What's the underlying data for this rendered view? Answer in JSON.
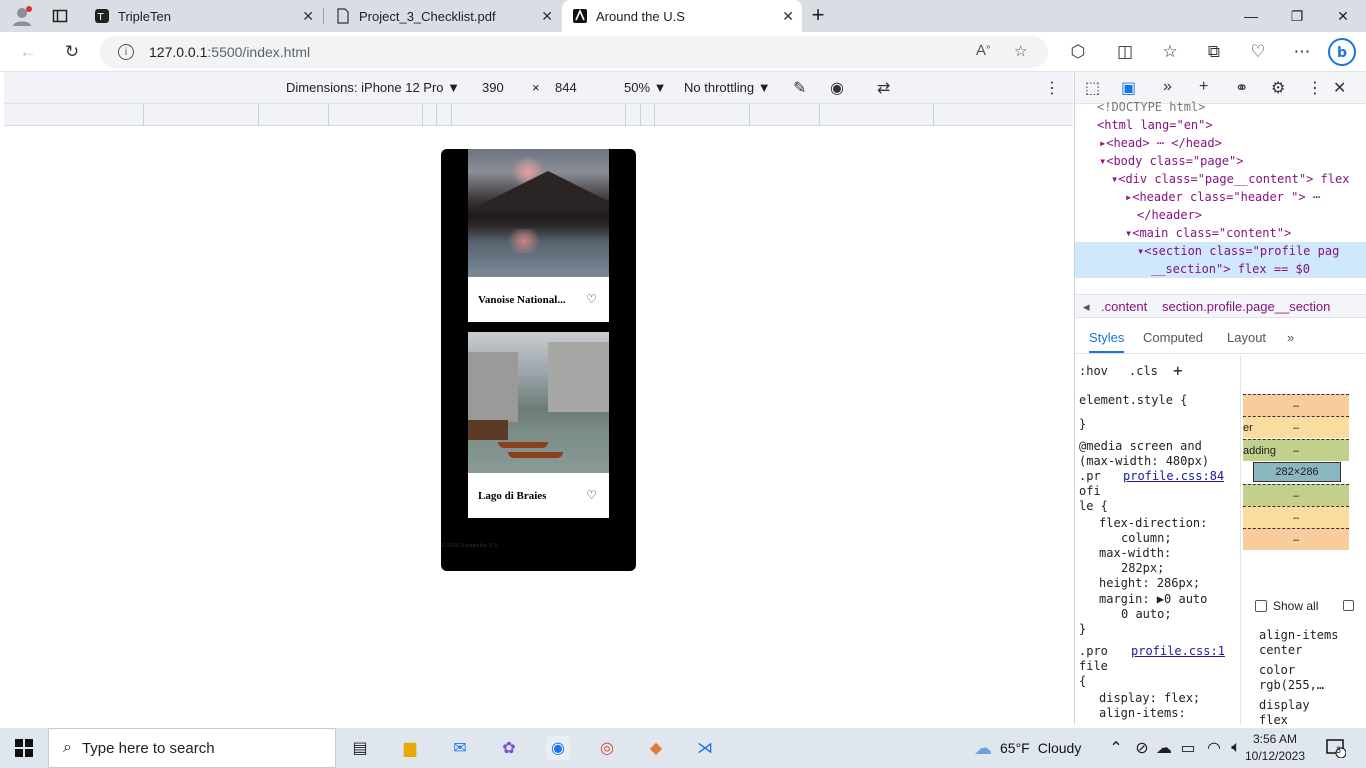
{
  "browser": {
    "tabs": [
      {
        "label": "TripleTen",
        "icon": "tripleten-icon"
      },
      {
        "label": "Project_3_Checklist.pdf",
        "icon": "pdf-icon"
      },
      {
        "label": "Around the U.S",
        "icon": "around-icon"
      }
    ],
    "new_tab": "+",
    "url_host": "127.0.0.1",
    "url_rest": ":5500/index.html"
  },
  "device_toolbar": {
    "dimensions_label": "Dimensions: iPhone 12 Pro",
    "width": "390",
    "times": "×",
    "height": "844",
    "zoom": "50%",
    "throttling": "No throttling"
  },
  "page": {
    "cards": [
      {
        "title": "Vanoise National...",
        "liked": false
      },
      {
        "title": "Lago di Braies",
        "liked": false
      }
    ],
    "footer": "© 2020 Around the U.S"
  },
  "devtools": {
    "dom_lines": [
      {
        "text": "<!DOCTYPE html>"
      },
      {
        "text": "<html lang=\"en\">"
      },
      {
        "text": "▸<head> ⋯ </head>"
      },
      {
        "text": "▾<body class=\"page\">"
      },
      {
        "text": "▾<div class=\"page__content\"> flex"
      },
      {
        "text": "▸<header class=\"header \"> ⋯"
      },
      {
        "text": "</header>"
      },
      {
        "text": "▾<main class=\"content\">"
      },
      {
        "text": "▾<section class=\"profile pag"
      },
      {
        "text": "__section\"> flex == $0"
      }
    ],
    "breadcrumbs": [
      ".content",
      "section.profile.page__section"
    ],
    "subtabs": [
      "Styles",
      "Computed",
      "Layout"
    ],
    "filter_buttons": [
      ":hov",
      ".cls"
    ],
    "styles_lines": [
      "element.style {",
      "}",
      "@media screen and",
      "(max-width: 480px)",
      ".pr",
      "ofi",
      "le {",
      "flex-direction:",
      "column;",
      "max-width:",
      "282px;",
      "height: 286px;",
      "margin: ▶0 auto",
      "0 auto;",
      "}",
      ".pro",
      "file",
      "{",
      "display: flex;",
      "align-items:"
    ],
    "links": [
      "profile.css:84",
      "profile.css:1"
    ],
    "box_labels": [
      "er",
      "adding"
    ],
    "box_dash": "–",
    "box_content": "282×286",
    "show_all": "Show all",
    "computed": [
      {
        "prop": "align-items",
        "value": "center"
      },
      {
        "prop": "color",
        "value": "rgb(255,…"
      },
      {
        "prop": "display",
        "value": "flex"
      }
    ]
  },
  "taskbar": {
    "search_placeholder": "Type here to search",
    "weather_temp": "65°F",
    "weather_text": "Cloudy",
    "time": "3:56 AM",
    "date": "10/12/2023",
    "notification_count": "3"
  }
}
